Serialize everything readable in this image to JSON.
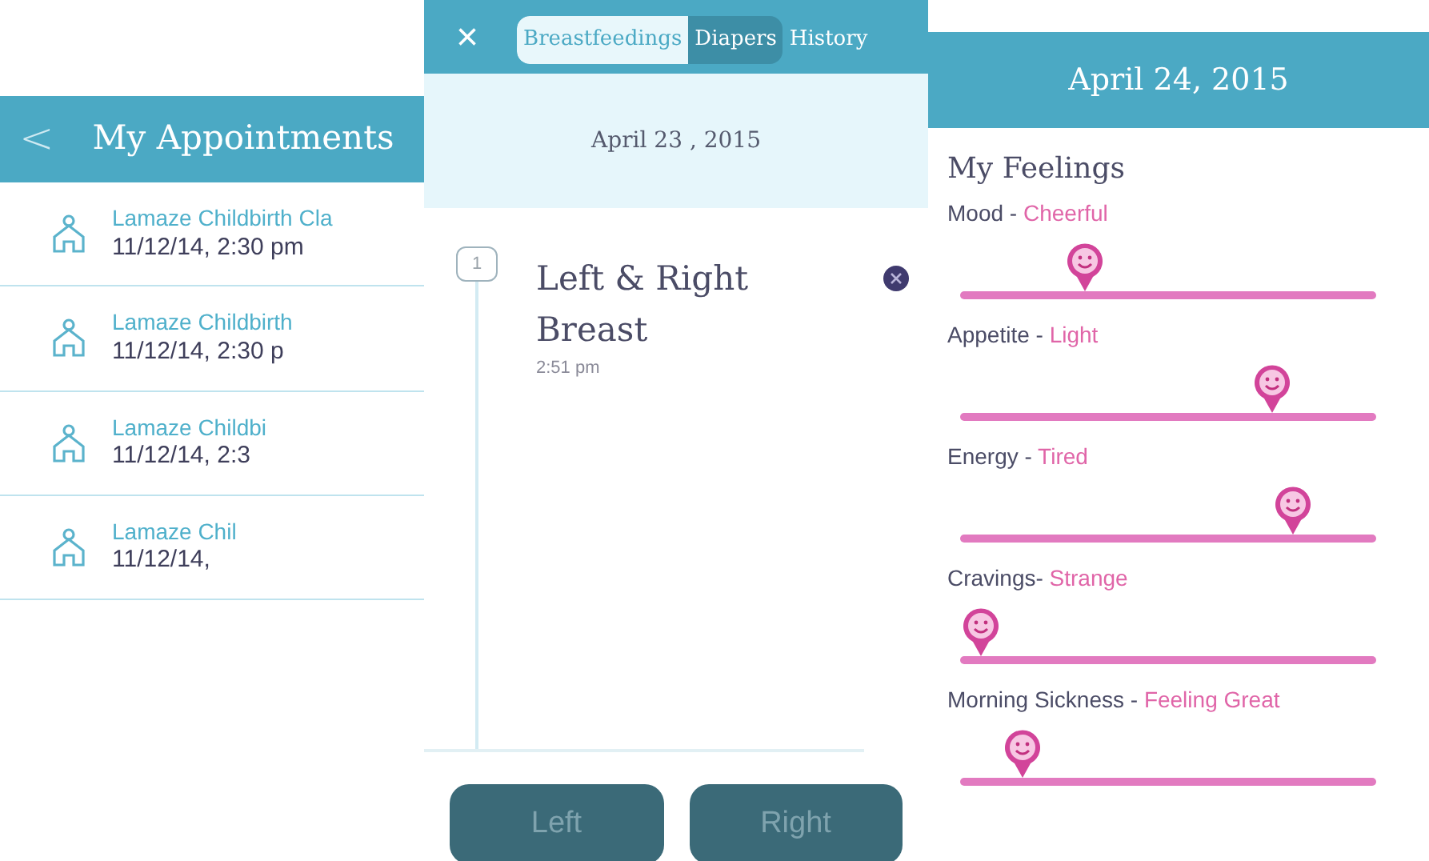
{
  "appointments_screen": {
    "title": "My Appointments",
    "back": "<",
    "items": [
      {
        "name": "Lamaze Childbirth Cla",
        "time": "11/12/14, 2:30 pm"
      },
      {
        "name": "Lamaze Childbirth",
        "time": "11/12/14, 2:30 p"
      },
      {
        "name": "Lamaze Childbi",
        "time": "11/12/14, 2:3"
      },
      {
        "name": "Lamaze Chil",
        "time": "11/12/14, "
      }
    ]
  },
  "feeding_screen": {
    "close": "×",
    "tabs": [
      {
        "label": "Breastfeedings",
        "selected": true,
        "pressed": false
      },
      {
        "label": "Diapers",
        "selected": false,
        "pressed": true
      },
      {
        "label": "History",
        "selected": false,
        "pressed": false
      }
    ],
    "date": "April 23 , 2015",
    "entries": [
      {
        "number": "1",
        "title": "Left & Right Breast",
        "time": "2:51 pm"
      }
    ],
    "buttons": [
      "Left",
      "Right"
    ]
  },
  "feelings_screen": {
    "date": "April 24, 2015",
    "heading": "My Feelings",
    "feelings": [
      {
        "name": "Mood -",
        "value": "Cheerful",
        "level": 0.3
      },
      {
        "name": "Appetite -",
        "value": "Light",
        "level": 0.75
      },
      {
        "name": "Energy -",
        "value": "Tired",
        "level": 0.8
      },
      {
        "name": "Cravings-",
        "value": "Strange",
        "level": 0.05
      },
      {
        "name": "Morning Sickness -",
        "value": "Feeling Great",
        "level": 0.15
      }
    ]
  }
}
